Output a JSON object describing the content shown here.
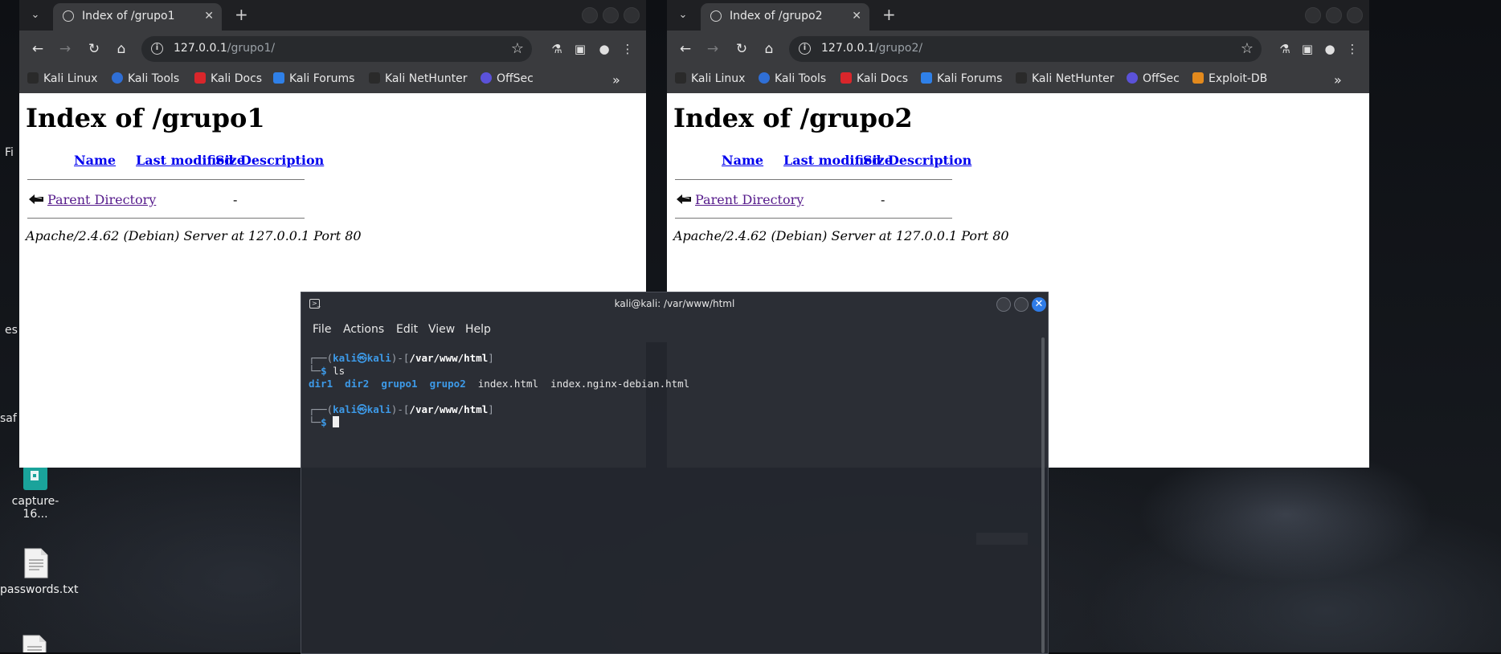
{
  "desktop": {
    "edge_texts": [
      "Fi",
      "es",
      "saf"
    ],
    "icons": [
      {
        "label": "capture-16...",
        "icon": "capture-file-icon"
      },
      {
        "label": "passwords.txt",
        "icon": "text-file-icon"
      },
      {
        "label": "",
        "icon": "text-file-icon"
      }
    ]
  },
  "browser_left": {
    "tab_title": "Index of /grupo1",
    "url_host": "127.0.0.1",
    "url_path": "/grupo1/",
    "bookmarks": [
      "Kali Linux",
      "Kali Tools",
      "Kali Docs",
      "Kali Forums",
      "Kali NetHunter",
      "OffSec"
    ],
    "page": {
      "heading": "Index of /grupo1",
      "columns": [
        "Name",
        "Last modified",
        "Size",
        "Description"
      ],
      "rows": [
        {
          "name": "Parent Directory",
          "size": "-"
        }
      ],
      "footer": "Apache/2.4.62 (Debian) Server at 127.0.0.1 Port 80"
    }
  },
  "browser_right": {
    "tab_title": "Index of /grupo2",
    "url_host": "127.0.0.1",
    "url_path": "/grupo2/",
    "bookmarks": [
      "Kali Linux",
      "Kali Tools",
      "Kali Docs",
      "Kali Forums",
      "Kali NetHunter",
      "OffSec",
      "Exploit-DB"
    ],
    "page": {
      "heading": "Index of /grupo2",
      "columns": [
        "Name",
        "Last modified",
        "Size",
        "Description"
      ],
      "rows": [
        {
          "name": "Parent Directory",
          "size": "-"
        }
      ],
      "footer": "Apache/2.4.62 (Debian) Server at 127.0.0.1 Port 80"
    }
  },
  "terminal": {
    "title": "kali@kali: /var/www/html",
    "menu": [
      "File",
      "Actions",
      "Edit",
      "View",
      "Help"
    ],
    "prompt": {
      "user": "kali",
      "host": "kali",
      "at": "㉿",
      "path": "/var/www/html"
    },
    "command": "ls",
    "ls_dirs": [
      "dir1",
      "dir2",
      "grupo1",
      "grupo2"
    ],
    "ls_files": [
      "index.html",
      "index.nginx-debian.html"
    ]
  },
  "colors": {
    "terminal_accent": "#3d9ae8",
    "close_button": "#2f7ce8",
    "link": "#0000ee",
    "visited_link": "#551a8b"
  }
}
